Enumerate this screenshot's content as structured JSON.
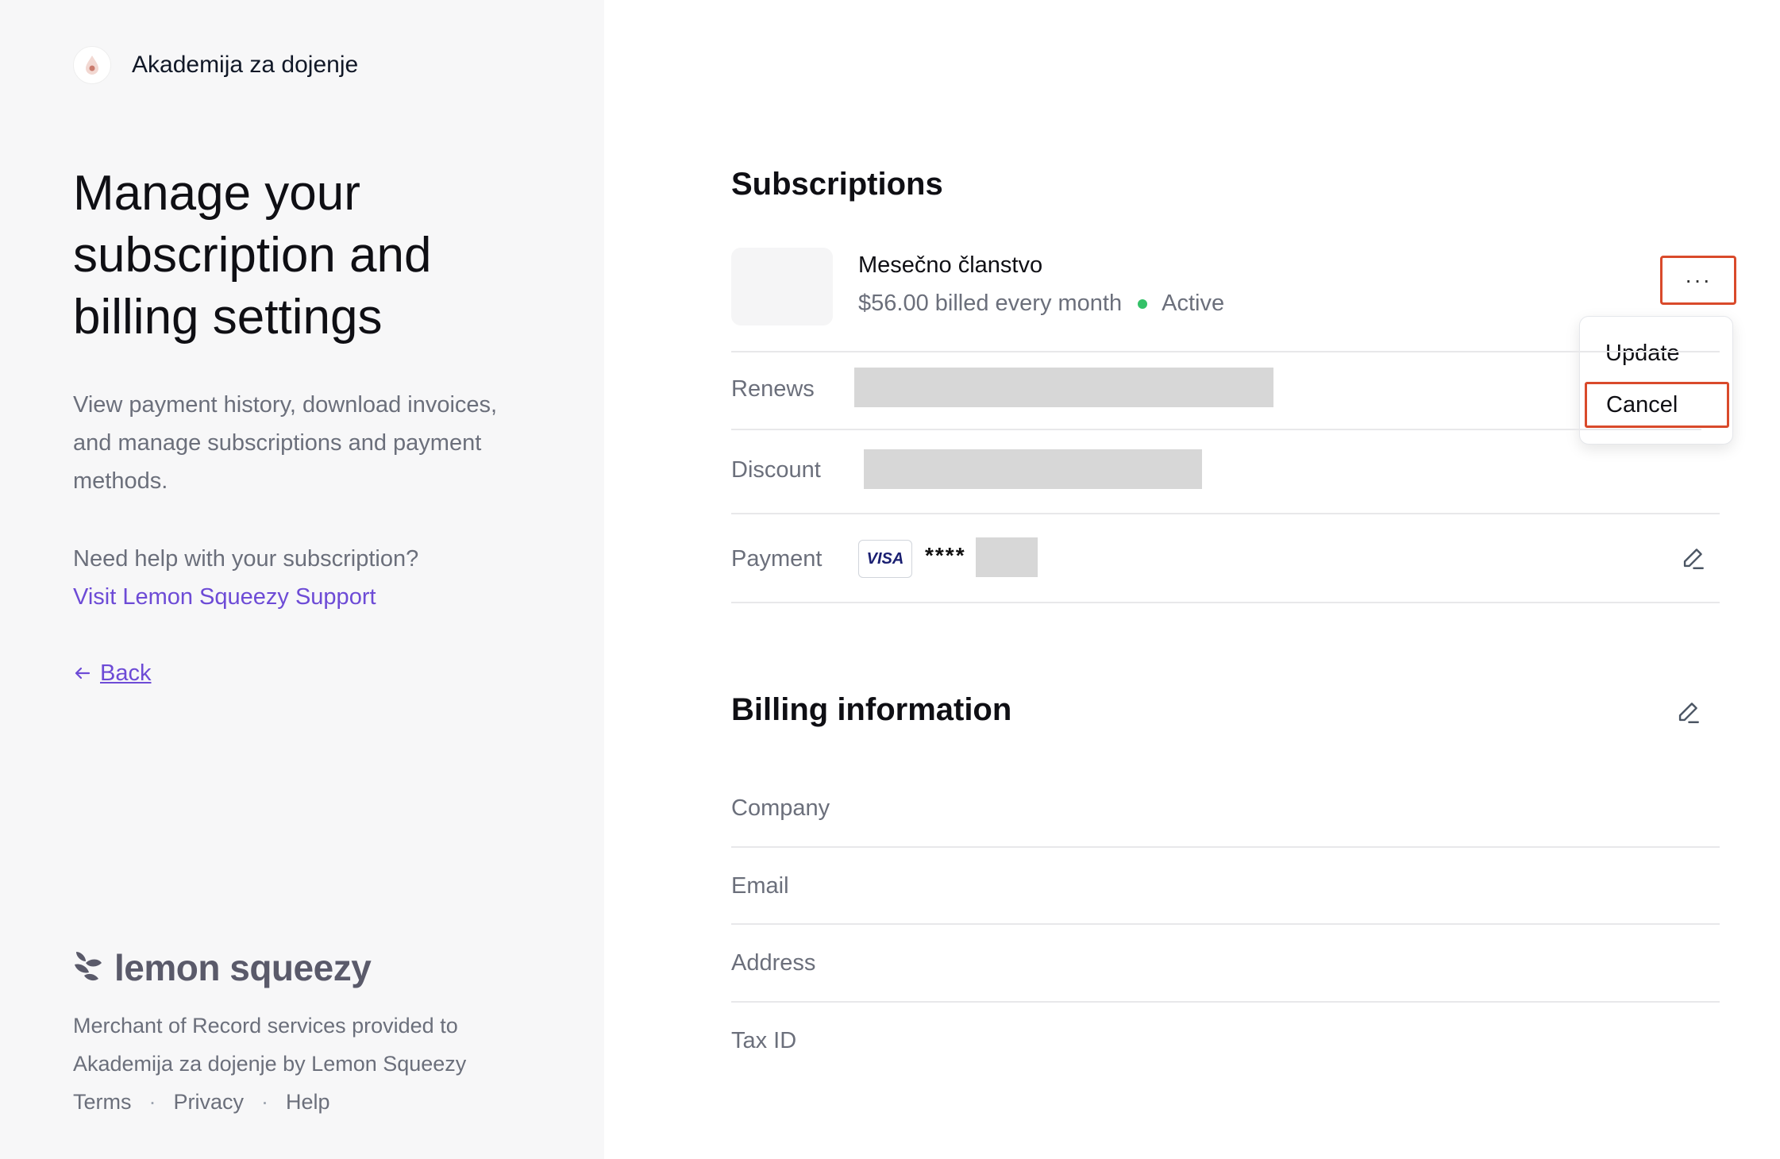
{
  "brand": {
    "name": "Akademija za dojenje"
  },
  "left": {
    "headline": "Manage your subscription and billing settings",
    "lede": "View payment history, download invoices, and manage subscriptions and payment methods.",
    "help_question": "Need help with your subscription?",
    "help_link": "Visit Lemon Squeezy Support",
    "back_label": "Back",
    "provider_logo": "lemon squeezy",
    "merchant_text": "Merchant of Record services provided to Akademija za dojenje by Lemon Squeezy",
    "footer_links": [
      "Terms",
      "Privacy",
      "Help"
    ]
  },
  "subscriptions": {
    "title": "Subscriptions",
    "plan_name": "Mesečno članstvo",
    "price_text": "$56.00 billed every month",
    "status": "Active",
    "more_label": "···",
    "menu": {
      "update": "Update",
      "cancel": "Cancel"
    },
    "rows": {
      "renews": "Renews",
      "discount": "Discount",
      "payment": "Payment"
    },
    "card_brand": "VISA",
    "card_mask": "****"
  },
  "billing": {
    "title": "Billing information",
    "fields": [
      "Company",
      "Email",
      "Address",
      "Tax ID"
    ]
  },
  "colors": {
    "accent": "#6d4bd6",
    "status_active": "#34c168",
    "highlight": "#d94a2b"
  }
}
